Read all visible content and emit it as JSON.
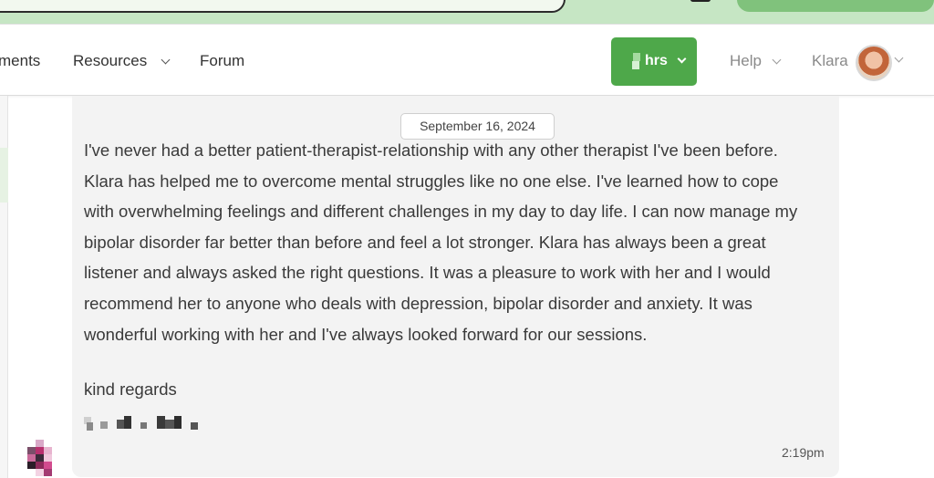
{
  "nav": {
    "items": [
      {
        "label": "ments"
      },
      {
        "label": "Resources"
      },
      {
        "label": "Forum"
      }
    ],
    "hours_button": {
      "label": "hrs"
    },
    "help": {
      "label": "Help"
    },
    "user": {
      "name": "Klara"
    }
  },
  "message": {
    "date": "September 16, 2024",
    "lines": [
      "I've never had a better patient-therapist-relationship with any other therapist I've been before.",
      "Klara has helped me to overcome mental struggles like no one else. I've learned how to cope",
      "with overwhelming feelings and different challenges in my day to day life. I can now manage my",
      "bipolar disorder far better than before and feel a lot stronger. Klara has always been a great",
      "listener and always asked the right questions. It was a pleasure to work with her and I would",
      "recommend her to anyone who deals with depression, bipolar disorder and anxiety. It was",
      "wonderful working with her and I've always looked forward for our sessions."
    ],
    "closing": "kind regards",
    "time": "2:19pm"
  },
  "colors": {
    "brand_green": "#4ea84a",
    "top_strip": "#c6e6c4",
    "card_bg": "#f3f3f3"
  }
}
